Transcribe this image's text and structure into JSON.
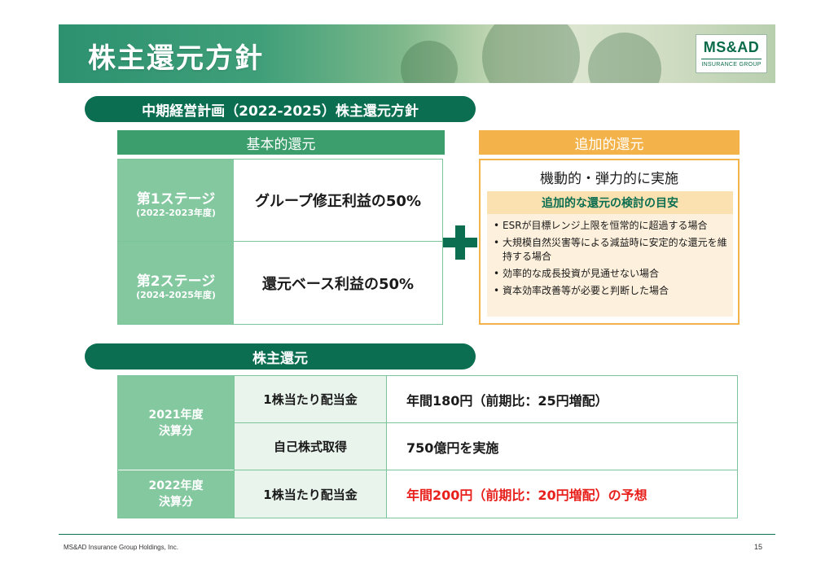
{
  "header": {
    "title": "株主還元方針",
    "logo": {
      "main": "MS&AD",
      "sub": "INSURANCE GROUP"
    }
  },
  "policy": {
    "section_title": "中期経営計画（2022-2025）株主還元方針",
    "basic": {
      "header": "基本的還元",
      "stages": [
        {
          "name": "第1ステージ",
          "years": "(2022-2023年度)",
          "value": "グループ修正利益の50%"
        },
        {
          "name": "第2ステージ",
          "years": "(2024-2025年度)",
          "value": "還元ベース利益の50%"
        }
      ]
    },
    "additional": {
      "header": "追加的還元",
      "title": "機動的・弾力的に実施",
      "guide_title": "追加的な還元の検討の目安",
      "items": [
        "ESRが目標レンジ上限を恒常的に超過する場合",
        "大規模自然災害等による減益時に安定的な還元を維持する場合",
        "効率的な成長投資が見通せない場合",
        "資本効率改善等が必要と判断した場合"
      ]
    }
  },
  "returns": {
    "section_title": "株主還元",
    "rows": [
      {
        "year": "2021年度\n決算分",
        "item": "1株当たり配当金",
        "value": "年間180円（前期比：25円増配）"
      },
      {
        "item": "自己株式取得",
        "value": "750億円を実施"
      },
      {
        "year": "2022年度\n決算分",
        "item": "1株当たり配当金",
        "value": "年間200円（前期比：20円増配）の予想"
      }
    ],
    "highlight_color": "#e8201c"
  },
  "footer": {
    "company": "MS&AD Insurance Group Holdings, Inc.",
    "page": "15"
  },
  "colors": {
    "primary_green": "#0b6e50",
    "light_green": "#84c8a0",
    "orange": "#f3b34a"
  }
}
